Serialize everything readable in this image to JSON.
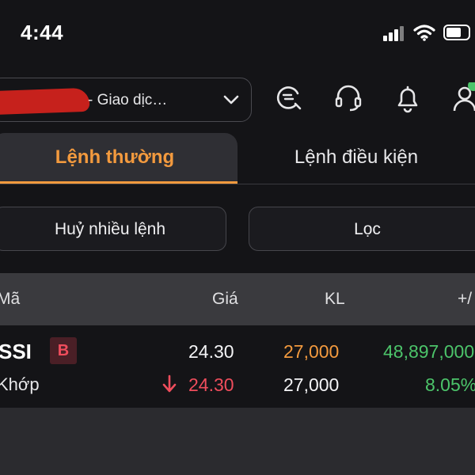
{
  "status_bar": {
    "time": "4:44"
  },
  "header": {
    "account_label": "- Giao dịc…",
    "icons": [
      "order-search-icon",
      "support-headset-icon",
      "bell-icon",
      "account-user-icon"
    ]
  },
  "tabs": [
    {
      "label": "Lệnh thường",
      "active": true
    },
    {
      "label": "Lệnh điều kiện",
      "active": false
    }
  ],
  "filters": {
    "cancel_label": "Huỷ nhiều lệnh",
    "filter_label": "Lọc"
  },
  "table": {
    "headers": {
      "symbol": "Mã",
      "price": "Giá",
      "volume": "KL",
      "change": "+/"
    },
    "rows": [
      {
        "symbol": "SSI",
        "side_badge": "B",
        "price": "24.30",
        "volume": "27,000",
        "value": "48,897,000",
        "status": "Khớp",
        "matched_price": "24.30",
        "matched_volume": "27,000",
        "percent": "8.05%"
      }
    ]
  },
  "colors": {
    "accent": "#f39a3e",
    "buy_red": "#ef4d5c",
    "positive_green": "#4cc46a",
    "background": "#141417"
  }
}
